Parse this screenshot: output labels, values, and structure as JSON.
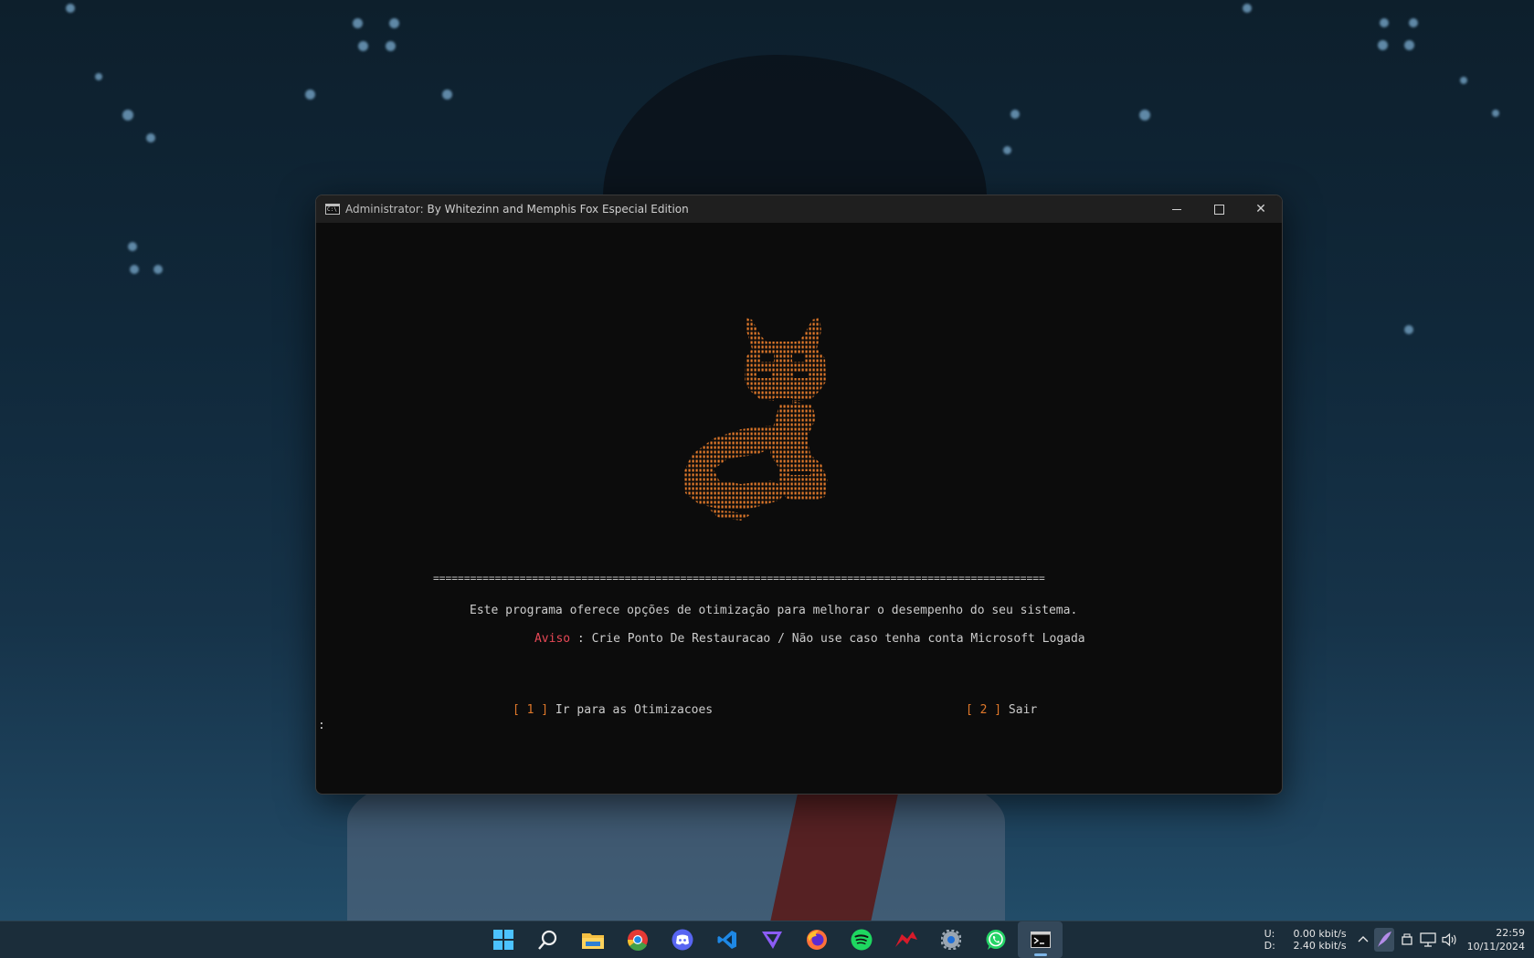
{
  "window": {
    "title_prefix": "Administrator:",
    "title": "By Whitezinn and Memphis Fox Especial Edition",
    "icon": "console-icon",
    "controls": {
      "minimize": "minimize-icon",
      "maximize": "maximize-icon",
      "close": "close-icon"
    }
  },
  "console": {
    "ascii_art": "fox",
    "art_color": "#e0782a",
    "rule": "===================================================================================================",
    "description": "Este programa oferece opções de otimização para melhorar o desempenho do seu sistema.",
    "warning_label": "Aviso",
    "warning_text": " : Crie Ponto De Restauracao / Não use caso tenha conta Microsoft Logada",
    "option1_open": "[ ",
    "option1_key": "1",
    "option1_close": " ]",
    "option1_label": " Ir para as Otimizacoes",
    "option2_open": "[ ",
    "option2_key": "2",
    "option2_close": " ]",
    "option2_label": " Sair",
    "prompt": ":"
  },
  "taskbar": {
    "apps": [
      "windows-start-icon",
      "search-icon",
      "file-explorer-icon",
      "chrome-icon",
      "discord-icon",
      "vscode-icon",
      "proton-vpn-icon",
      "firefox-icon",
      "spotify-icon",
      "redragon-icon",
      "settings-icon",
      "whatsapp-icon",
      "terminal-icon"
    ],
    "active_app": "terminal-icon",
    "net": {
      "up_label": "U:",
      "up_value": "0.00 kbit/s",
      "down_label": "D:",
      "down_value": "2.40 kbit/s"
    },
    "tray_icons": [
      "chevron-up-icon",
      "feather-app-icon",
      "usb-icon",
      "network-icon",
      "volume-icon"
    ],
    "clock": {
      "time": "22:59",
      "date": "10/11/2024"
    }
  }
}
